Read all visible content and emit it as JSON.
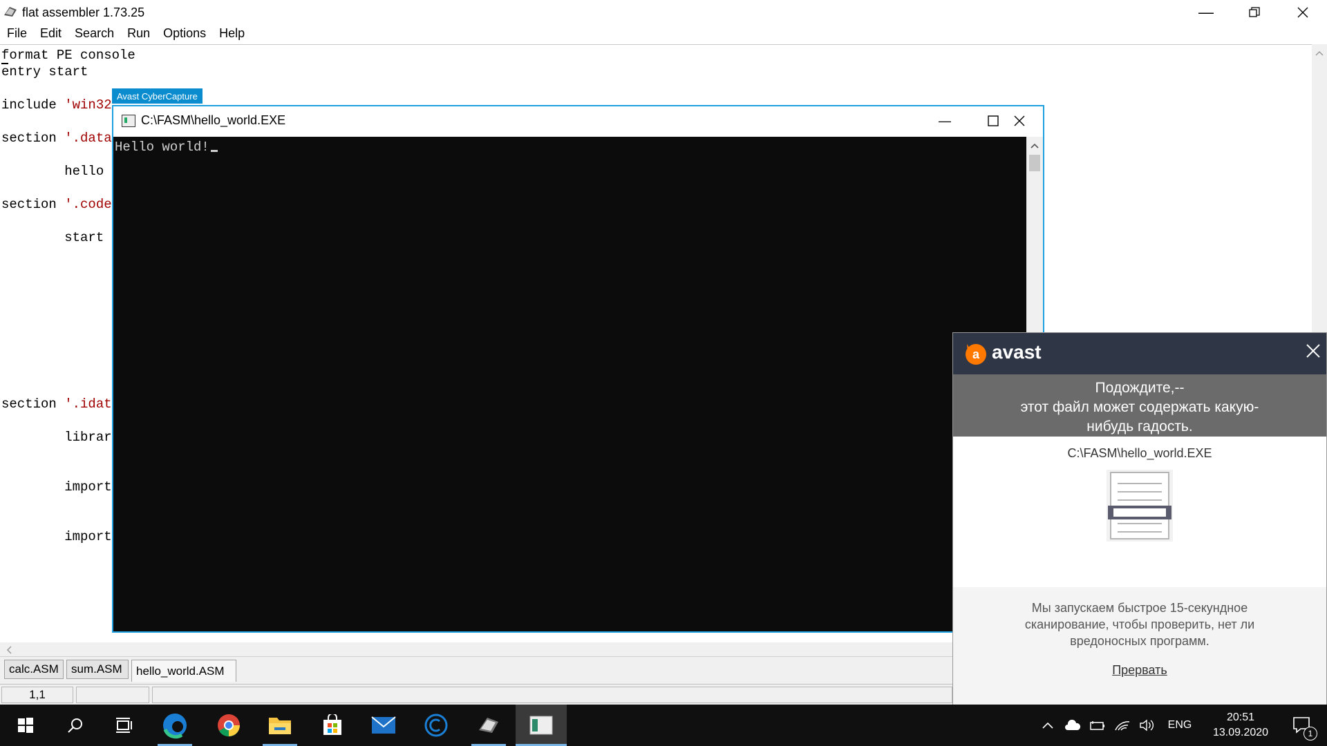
{
  "app": {
    "title": "flat assembler 1.73.25",
    "menu": [
      "File",
      "Edit",
      "Search",
      "Run",
      "Options",
      "Help"
    ]
  },
  "editor": {
    "lines": [
      {
        "kw": "format PE console",
        "str": ""
      },
      {
        "kw": "entry start",
        "str": ""
      },
      {
        "kw": "include ",
        "str": "'win32"
      },
      {
        "kw": "section ",
        "str": "'.data"
      },
      {
        "kw": "        hello",
        "str": ""
      },
      {
        "kw": "section ",
        "str": "'.code"
      },
      {
        "kw": "        start",
        "str": ""
      },
      {
        "kw": "section ",
        "str": "'.idat"
      },
      {
        "kw": "        librar",
        "str": ""
      },
      {
        "kw": "        import",
        "str": ""
      },
      {
        "kw": "        import",
        "str": ""
      }
    ],
    "tabs": [
      "calc.ASM",
      "sum.ASM",
      "hello_world.ASM"
    ],
    "status_position": "1,1"
  },
  "console": {
    "tag": "Avast CyberCapture",
    "title": "C:\\FASM\\hello_world.EXE",
    "output": "Hello world!"
  },
  "avast": {
    "brand": "avast",
    "banner_line1": "Подождите,--",
    "banner_line2": "этот файл может содержать какую-",
    "banner_line3": "нибудь гадость.",
    "file_path": "C:\\FASM\\hello_world.EXE",
    "message_line1": "Мы запускаем быстрое 15-секундное",
    "message_line2": "сканирование, чтобы проверить, нет ли",
    "message_line3": "вредоносных программ.",
    "abort_label": "Прервать",
    "accent_color": "#ff7800"
  },
  "taskbar": {
    "lang": "ENG",
    "time": "20:51",
    "date": "13.09.2020",
    "notification_count": "1"
  }
}
